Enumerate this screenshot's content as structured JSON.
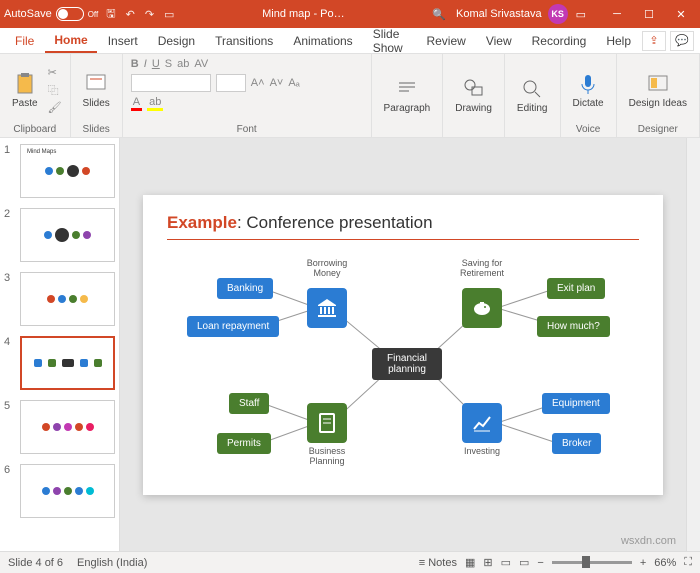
{
  "titlebar": {
    "autosave": "AutoSave",
    "off": "Off",
    "doctitle": "Mind map - Po…",
    "search": "🔍",
    "user": "Komal Srivastava",
    "initials": "KS"
  },
  "tabs": {
    "file": "File",
    "home": "Home",
    "insert": "Insert",
    "design": "Design",
    "transitions": "Transitions",
    "animations": "Animations",
    "slideshow": "Slide Show",
    "review": "Review",
    "view": "View",
    "recording": "Recording",
    "help": "Help"
  },
  "ribbon": {
    "clipboard": {
      "paste": "Paste",
      "label": "Clipboard"
    },
    "slides": {
      "btn": "Slides",
      "label": "Slides"
    },
    "font": {
      "label": "Font",
      "bold": "B",
      "italic": "I",
      "underline": "U",
      "strike": "S",
      "fontbox": "",
      "sizebox": "",
      "increase": "A˄",
      "decrease": "A˅",
      "clear": "A"
    },
    "paragraph": {
      "btn": "Paragraph",
      "label": ""
    },
    "drawing": {
      "btn": "Drawing",
      "label": ""
    },
    "editing": {
      "btn": "Editing",
      "label": ""
    },
    "voice": {
      "btn": "Dictate",
      "label": "Voice"
    },
    "designer": {
      "btn": "Design Ideas",
      "label": "Designer"
    }
  },
  "thumbs": [
    "1",
    "2",
    "3",
    "4",
    "5",
    "6"
  ],
  "slide": {
    "title_prefix": "Example",
    "title_rest": ": Conference presentation",
    "center": "Financial planning",
    "banking": "Banking",
    "loan": "Loan repayment",
    "borrow": "Borrowing Money",
    "saving": "Saving for Retirement",
    "exit": "Exit plan",
    "howmuch": "How much?",
    "staff": "Staff",
    "permits": "Permits",
    "business": "Business Planning",
    "investing": "Investing",
    "equipment": "Equipment",
    "broker": "Broker"
  },
  "status": {
    "slide": "Slide 4 of 6",
    "lang": "English (India)",
    "notes": "Notes",
    "zoom": "66%"
  },
  "watermark": "wsxdn.com"
}
